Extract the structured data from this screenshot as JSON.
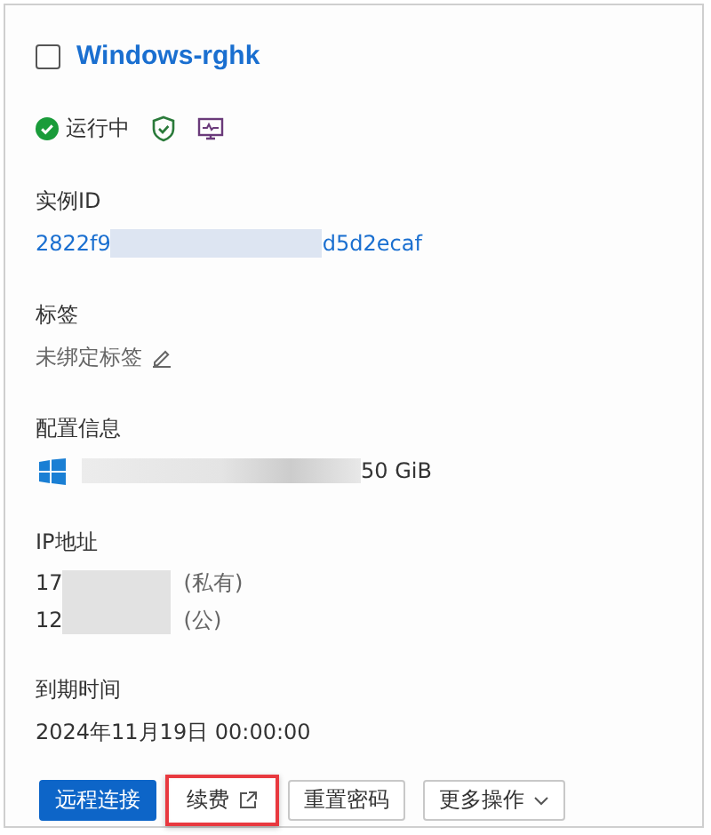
{
  "header": {
    "checked": false,
    "title": "Windows-rghk"
  },
  "status": {
    "label": "运行中",
    "ok": true
  },
  "instance_id": {
    "label": "实例ID",
    "start": "2822f9",
    "end": "d5d2ecaf"
  },
  "tags": {
    "label": "标签",
    "value": "未绑定标签"
  },
  "config": {
    "label": "配置信息",
    "end": "50 GiB"
  },
  "ip": {
    "label": "IP地址",
    "rows": [
      {
        "start": "17",
        "note": "(私有)"
      },
      {
        "start": "12",
        "note": "(公)"
      }
    ]
  },
  "expiry": {
    "label": "到期时间",
    "value": "2024年11月19日 00:00:00"
  },
  "buttons": [
    {
      "kind": "primary",
      "label": "远程连接",
      "highlighted": false
    },
    {
      "kind": "external",
      "label": "续费",
      "highlighted": true
    },
    {
      "kind": "plain",
      "label": "重置密码",
      "highlighted": false
    },
    {
      "kind": "dropdown",
      "label": "更多操作",
      "highlighted": false
    }
  ]
}
